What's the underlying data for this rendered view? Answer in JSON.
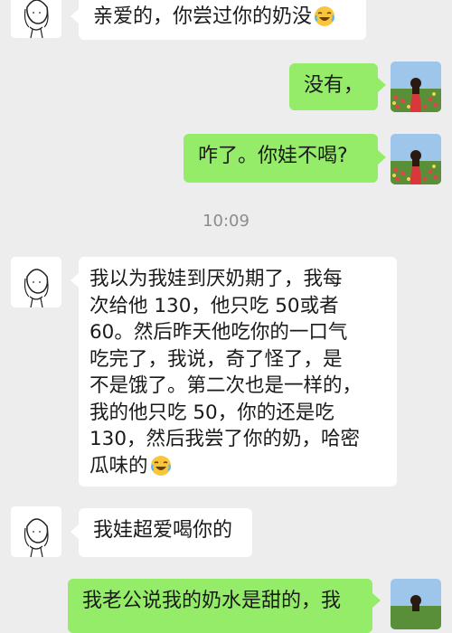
{
  "messages": [
    {
      "side": "left",
      "text": "亲爱的，你尝过你的奶没",
      "emoji": "laughing-tears-emoji"
    },
    {
      "side": "right",
      "text": "没有，"
    },
    {
      "side": "right",
      "text": "咋了。你娃不喝?"
    },
    {
      "side": "left",
      "text": "我以为我娃到厌奶期了，我每\n次给他 130，他只吃 50或者\n60。然后昨天他吃你的一口气\n吃完了，我说，奇了怪了，是\n不是饿了。第二次也是一样的，\n我的他只吃 50，你的还是吃\n130，然后我尝了你的奶，哈密\n瓜味的",
      "emoji": "laughing-tears-emoji"
    },
    {
      "side": "left",
      "text": "我娃超爱喝你的"
    },
    {
      "side": "right",
      "text": "我老公说我的奶水是甜的，我"
    }
  ],
  "timestamp": "10:09",
  "avatars": {
    "left": "sketch-girl-avatar",
    "right": "tulip-field-photo-avatar"
  },
  "colors": {
    "background": "#ededed",
    "bubble_left": "#ffffff",
    "bubble_right": "#95ec69",
    "timestamp": "#8c8c8c"
  }
}
